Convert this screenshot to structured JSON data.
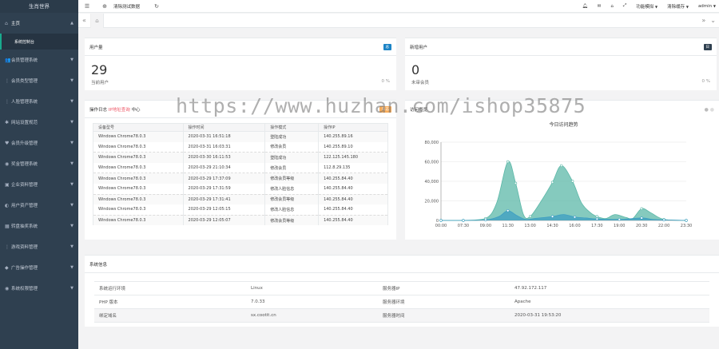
{
  "sidebar": {
    "brand": "生肖世界",
    "home": {
      "label": "主页",
      "sub": "系统控制台"
    },
    "items": [
      {
        "icon": "users-icon",
        "glyph": "👥",
        "label": "会员管理系统"
      },
      {
        "icon": "tag-icon",
        "glyph": "⋮",
        "label": "会员类型管理"
      },
      {
        "icon": "user-icon",
        "glyph": "⋮",
        "label": "人脸管理系统"
      },
      {
        "icon": "star-icon",
        "glyph": "✱",
        "label": "网站设置规范"
      },
      {
        "icon": "heart-icon",
        "glyph": "♥",
        "label": "会员升级管理"
      },
      {
        "icon": "money-icon",
        "glyph": "◉",
        "label": "奖金管理系统"
      },
      {
        "icon": "building-icon",
        "glyph": "▣",
        "label": "企业资料管理"
      },
      {
        "icon": "asset-icon",
        "glyph": "◐",
        "label": "用户资产管理"
      },
      {
        "icon": "grid-icon",
        "glyph": "▦",
        "label": "转盘抽奖系统"
      },
      {
        "icon": "game-icon",
        "glyph": "⋮",
        "label": "游戏资料管理"
      },
      {
        "icon": "ad-icon",
        "glyph": "◆",
        "label": "广告操作管理"
      },
      {
        "icon": "lock-icon",
        "glyph": "◉",
        "label": "系统权限管理"
      }
    ]
  },
  "topbar": {
    "clear_test": "清除测试数据",
    "func_menu": "功能模拟",
    "clear_cache": "清除缓存",
    "admin": "admin"
  },
  "users_card": {
    "title": "用户量",
    "badge": "总",
    "number": "29",
    "sub": "当前用户",
    "pct": "0 %"
  },
  "new_card": {
    "title": "新增用户",
    "badge": "日",
    "number": "0",
    "sub": "未审会员",
    "pct": "0 %"
  },
  "log_panel": {
    "title_prefix": "操作日志",
    "title_link": "IP地址查询",
    "title_suffix": "中心",
    "badge": "日志",
    "columns": [
      "设备型号",
      "操作时间",
      "操作模式",
      "操作IP"
    ],
    "rows": [
      [
        "Windows Chrome78.0.3",
        "2020-03-31 16:51:18",
        "登陆成功",
        "140.255.89.16"
      ],
      [
        "Windows Chrome78.0.3",
        "2020-03-31 16:03:31",
        "修改会员",
        "140.255.89.10"
      ],
      [
        "Windows Chrome78.0.3",
        "2020-03-30 16:11:53",
        "登陆成功",
        "122.125.145.180"
      ],
      [
        "Windows Chrome78.0.3",
        "2020-03-29 21:10:34",
        "修改会员",
        "112.8.29.135"
      ],
      [
        "Windows Chrome78.0.3",
        "2020-03-29 17:37:09",
        "修改会员等级",
        "140.255.84.40"
      ],
      [
        "Windows Chrome78.0.3",
        "2020-03-29 17:31:59",
        "修改人脸信息",
        "140.255.84.40"
      ],
      [
        "Windows Chrome78.0.3",
        "2020-03-29 17:31:41",
        "修改会员等级",
        "140.255.84.40"
      ],
      [
        "Windows Chrome78.0.3",
        "2020-03-29 12:05:15",
        "修改人脸信息",
        "140.255.84.40"
      ],
      [
        "Windows Chrome78.0.3",
        "2020-03-29 12:05:07",
        "修改会员等级",
        "140.255.84.40"
      ]
    ]
  },
  "chart_panel": {
    "title": "访问概览"
  },
  "chart_data": {
    "type": "area",
    "title": "今日访问趋势",
    "x": [
      "00:00",
      "07:30",
      "09:00",
      "11:30",
      "13:00",
      "14:30",
      "16:00",
      "17:30",
      "19:00",
      "20:30",
      "22:00",
      "23:30"
    ],
    "yticks": [
      "0",
      "20,000",
      "40,000",
      "60,000",
      "80,000"
    ],
    "ylim": [
      0,
      80000
    ],
    "series": [
      {
        "color": "#5cb8a8",
        "points": [
          [
            0,
            0
          ],
          [
            1,
            0
          ],
          [
            2,
            2000
          ],
          [
            2.5,
            18000
          ],
          [
            3,
            60000
          ],
          [
            3.35,
            38000
          ],
          [
            3.7,
            6000
          ],
          [
            4,
            4000
          ],
          [
            4.5,
            20000
          ],
          [
            5,
            39000
          ],
          [
            5.4,
            56000
          ],
          [
            5.9,
            40000
          ],
          [
            6.3,
            18000
          ],
          [
            6.7,
            8000
          ],
          [
            7,
            4000
          ],
          [
            7.4,
            2000
          ],
          [
            7.8,
            6000
          ],
          [
            8.3,
            3000
          ],
          [
            8.6,
            2000
          ],
          [
            9,
            12000
          ],
          [
            9.4,
            8000
          ],
          [
            10,
            1000
          ],
          [
            11,
            0
          ]
        ]
      },
      {
        "color": "#3d9ec2",
        "points": [
          [
            0,
            0
          ],
          [
            1,
            0
          ],
          [
            2,
            500
          ],
          [
            2.6,
            4000
          ],
          [
            3,
            10000
          ],
          [
            3.4,
            5000
          ],
          [
            3.8,
            1000
          ],
          [
            4.2,
            2000
          ],
          [
            5,
            4000
          ],
          [
            5.5,
            6000
          ],
          [
            6,
            3500
          ],
          [
            6.5,
            2500
          ],
          [
            7,
            1500
          ],
          [
            8,
            1000
          ],
          [
            9,
            2500
          ],
          [
            9.5,
            1000
          ],
          [
            10,
            500
          ],
          [
            11,
            0
          ]
        ]
      }
    ]
  },
  "system_info": {
    "title": "系统信息",
    "rows": [
      [
        "系统运行环境",
        "Linux",
        "服务器IP",
        "47.92.172.117"
      ],
      [
        "PHP 版本",
        "7.0.33",
        "服务器环境",
        "Apache"
      ],
      [
        "绑定域名",
        "sx.cootit.cn",
        "服务器时间",
        "2020-03-31 19:53:20"
      ]
    ]
  },
  "watermark": "https://www.huzhan.com/ishop35875",
  "colors": {
    "sidebar": "#2f4050",
    "accent": "#19aa8d",
    "badge_blue": "#1c84c6",
    "badge_dark": "#2f4050",
    "badge_orange": "#f8ac59"
  }
}
